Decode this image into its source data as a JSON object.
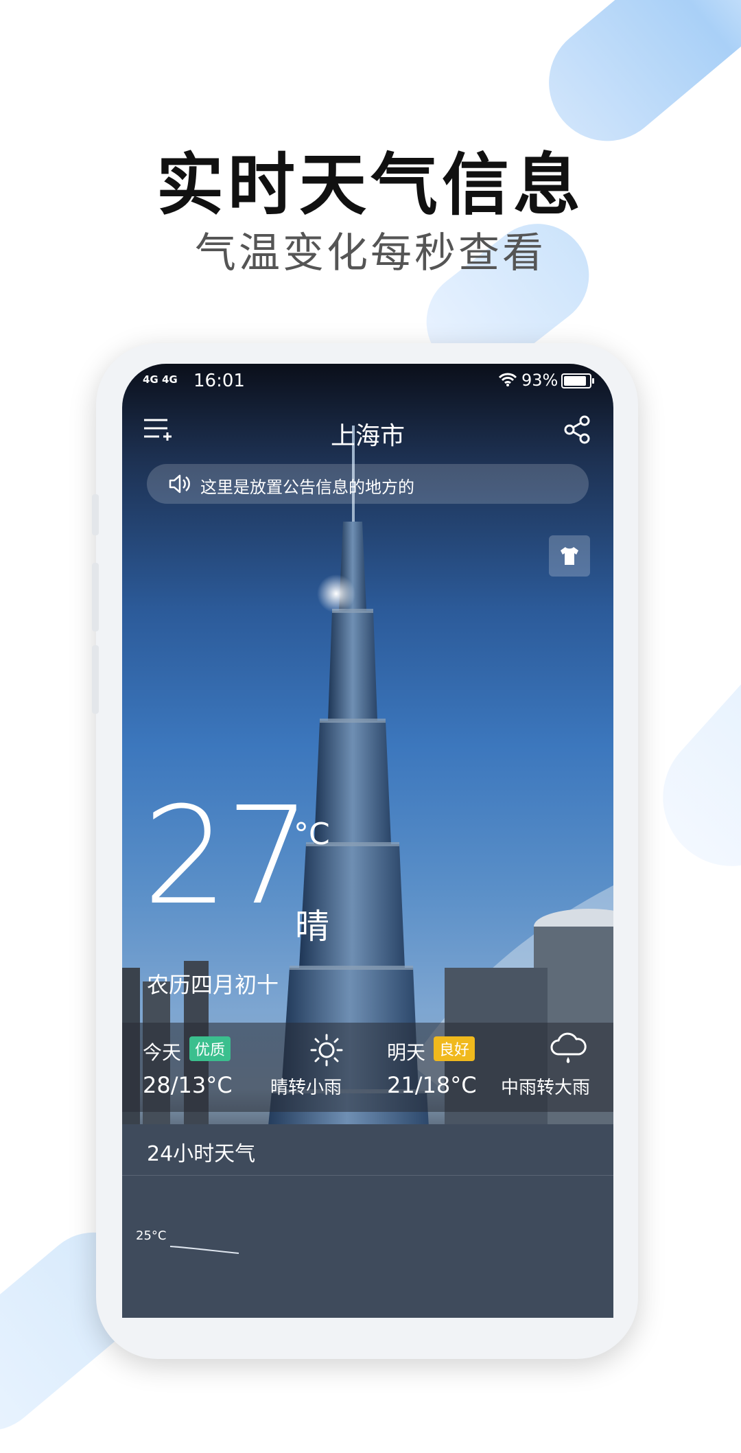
{
  "promo": {
    "headline": "实时天气信息",
    "subline": "气温变化每秒查看"
  },
  "status_bar": {
    "signal": "4G 4G",
    "time": "16:01",
    "battery": "93%",
    "battery_level": 0.93
  },
  "header": {
    "city": "上海市"
  },
  "notice": {
    "text": "这里是放置公告信息的地方的"
  },
  "current": {
    "temperature": "27",
    "unit": "°C",
    "condition": "晴",
    "lunar_date": "农历四月初十"
  },
  "forecast": [
    {
      "day": "今天",
      "aqi": "优质",
      "aqi_color": "#3bbf8e",
      "range": "28/13°C",
      "desc": "晴转小雨",
      "icon": "sun-icon"
    },
    {
      "day": "明天",
      "aqi": "良好",
      "aqi_color": "#f0b91d",
      "range": "21/18°C",
      "desc": "中雨转大雨",
      "icon": "rain-cloud-icon"
    }
  ],
  "hourly": {
    "title": "24小时天气",
    "first_temp": "25°C"
  },
  "colors": {
    "accent_good": "#3bbf8e",
    "accent_fair": "#f0b91d"
  }
}
